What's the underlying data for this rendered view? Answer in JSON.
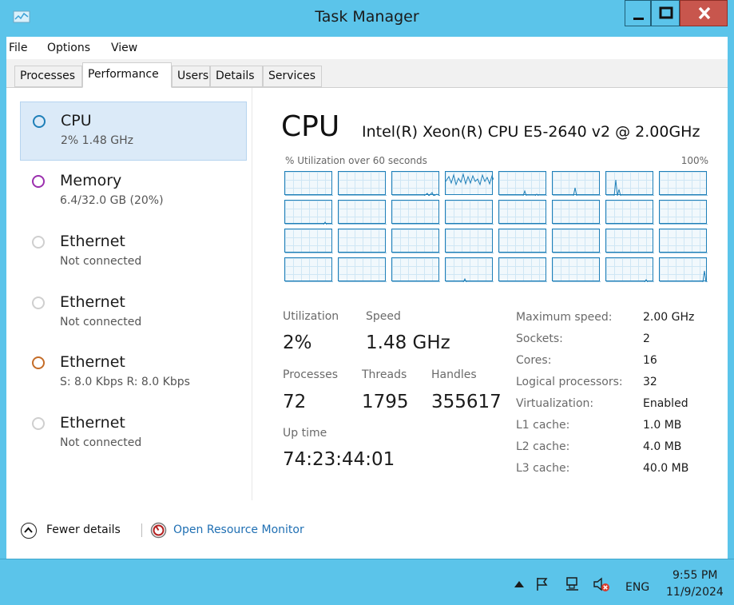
{
  "window": {
    "title": "Task Manager"
  },
  "menu": [
    "File",
    "Options",
    "View"
  ],
  "tabs": [
    "Processes",
    "Performance",
    "Users",
    "Details",
    "Services"
  ],
  "active_tab": "Performance",
  "resources": [
    {
      "name": "CPU",
      "detail": "2% 1.48 GHz",
      "color": "#1e7fb8",
      "selected": true
    },
    {
      "name": "Memory",
      "detail": "6.4/32.0 GB (20%)",
      "color": "#9b2fae",
      "selected": false
    },
    {
      "name": "Ethernet",
      "detail": "Not connected",
      "color": "#bdbdbd",
      "selected": false
    },
    {
      "name": "Ethernet",
      "detail": "Not connected",
      "color": "#bdbdbd",
      "selected": false
    },
    {
      "name": "Ethernet",
      "detail": "S: 8.0 Kbps R: 8.0 Kbps",
      "color": "#c46c27",
      "selected": false
    },
    {
      "name": "Ethernet",
      "detail": "Not connected",
      "color": "#bdbdbd",
      "selected": false
    }
  ],
  "cpu": {
    "title": "CPU",
    "model": "Intel(R) Xeon(R) CPU E5-2640 v2 @ 2.00GHz",
    "util_caption": "% Utilization over 60 seconds",
    "util_max": "100%",
    "stats": {
      "utilization": {
        "label": "Utilization",
        "value": "2%"
      },
      "speed": {
        "label": "Speed",
        "value": "1.48 GHz"
      },
      "processes": {
        "label": "Processes",
        "value": "72"
      },
      "threads": {
        "label": "Threads",
        "value": "1795"
      },
      "handles": {
        "label": "Handles",
        "value": "355617"
      },
      "uptime": {
        "label": "Up time",
        "value": "74:23:44:01"
      }
    },
    "specs": [
      {
        "label": "Maximum speed:",
        "value": "2.00 GHz"
      },
      {
        "label": "Sockets:",
        "value": "2"
      },
      {
        "label": "Cores:",
        "value": "16"
      },
      {
        "label": "Logical processors:",
        "value": "32"
      },
      {
        "label": "Virtualization:",
        "value": "Enabled"
      },
      {
        "label": "L1 cache:",
        "value": "1.0 MB"
      },
      {
        "label": "L2 cache:",
        "value": "4.0 MB"
      },
      {
        "label": "L3 cache:",
        "value": "40.0 MB"
      }
    ]
  },
  "footer": {
    "fewer_details": "Fewer details",
    "open_resource_monitor": "Open Resource Monitor"
  },
  "taskbar": {
    "lang": "ENG",
    "time": "9:55 PM",
    "date": "11/9/2024"
  },
  "colors": {
    "titlebar": "#5bc4ea",
    "graph_line": "#1e7fb8",
    "link": "#1f6fb3"
  },
  "icons": [
    "task-manager-icon",
    "minimize-icon",
    "maximize-icon",
    "close-icon",
    "chevron-up-icon",
    "resource-monitor-icon",
    "tray-up-arrow-icon",
    "flag-icon",
    "network-icon",
    "speaker-muted-icon"
  ]
}
